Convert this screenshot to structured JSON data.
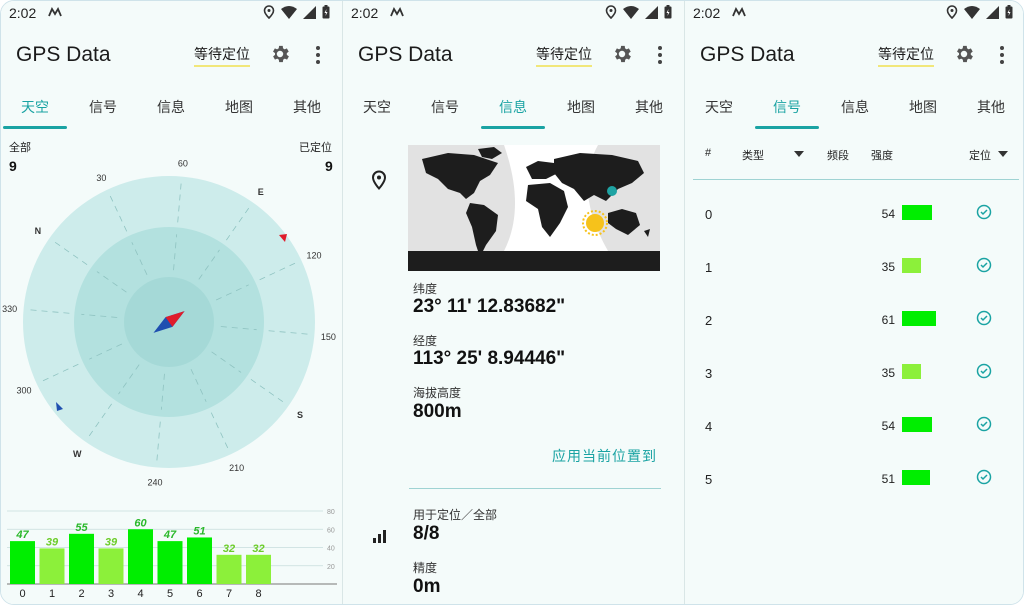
{
  "status": {
    "time": "2:02"
  },
  "app": {
    "title": "GPS Data",
    "wait_chip": "等待定位"
  },
  "tabs": [
    "天空",
    "信号",
    "信息",
    "地图",
    "其他"
  ],
  "sky": {
    "all_label": "全部",
    "all_count": "9",
    "fixed_label": "已定位",
    "fixed_count": "9",
    "compass_labels": [
      "N",
      "30",
      "60",
      "E",
      "120",
      "150",
      "S",
      "210",
      "240",
      "W",
      "300",
      "330"
    ],
    "bar_chart": {
      "categories": [
        "0",
        "1",
        "2",
        "3",
        "4",
        "5",
        "6",
        "7",
        "8"
      ],
      "values": [
        47,
        39,
        55,
        39,
        60,
        47,
        51,
        32,
        32
      ],
      "y_ticks": [
        "80",
        "60",
        "40",
        "20"
      ]
    }
  },
  "info": {
    "lat_label": "纬度",
    "lat_value": "23° 11' 12.83682\"",
    "lon_label": "经度",
    "lon_value": "113° 25' 8.94446\"",
    "alt_label": "海拔高度",
    "alt_value": "800m",
    "apply_link": "应用当前位置到",
    "used_label": "用于定位／全部",
    "used_value": "8/8",
    "acc_label": "精度",
    "acc_value": "0m"
  },
  "signal": {
    "headers": {
      "num": "#",
      "type": "类型",
      "band": "频段",
      "strength": "强度",
      "fix": "定位"
    },
    "rows": [
      {
        "id": "0",
        "strength": "54"
      },
      {
        "id": "1",
        "strength": "35"
      },
      {
        "id": "2",
        "strength": "61"
      },
      {
        "id": "3",
        "strength": "35"
      },
      {
        "id": "4",
        "strength": "54"
      },
      {
        "id": "5",
        "strength": "51"
      }
    ]
  },
  "colors": {
    "accent": "#1aa3a3",
    "bar_strong": "#00ee00",
    "bar_weak": "#8cf03a",
    "chip_underline": "#f1e77a"
  }
}
